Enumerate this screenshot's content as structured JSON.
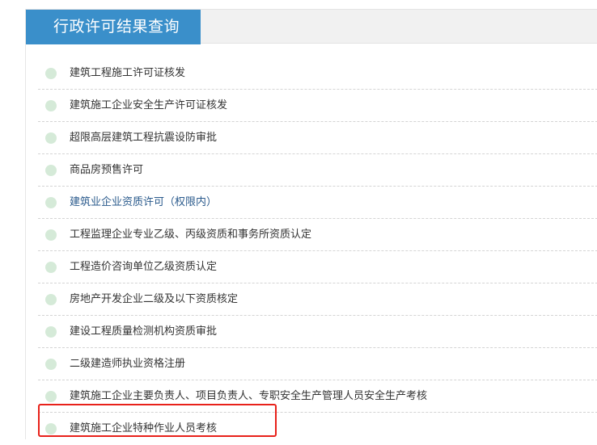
{
  "header": {
    "title": "行政许可结果查询"
  },
  "items": [
    {
      "label": "建筑工程施工许可证核发",
      "link_style": false
    },
    {
      "label": "建筑施工企业安全生产许可证核发",
      "link_style": false
    },
    {
      "label": "超限高层建筑工程抗震设防审批",
      "link_style": false
    },
    {
      "label": "商品房预售许可",
      "link_style": false
    },
    {
      "label": "建筑业企业资质许可（权限内）",
      "link_style": true
    },
    {
      "label": "工程监理企业专业乙级、丙级资质和事务所资质认定",
      "link_style": false
    },
    {
      "label": "工程造价咨询单位乙级资质认定",
      "link_style": false
    },
    {
      "label": "房地产开发企业二级及以下资质核定",
      "link_style": false
    },
    {
      "label": "建设工程质量检测机构资质审批",
      "link_style": false
    },
    {
      "label": "二级建造师执业资格注册",
      "link_style": false
    },
    {
      "label": "建筑施工企业主要负责人、项目负责人、专职安全生产管理人员安全生产考核",
      "link_style": false
    },
    {
      "label": "建筑施工企业特种作业人员考核",
      "link_style": false,
      "highlighted": true
    }
  ],
  "colors": {
    "header_tab": "#3a8fca",
    "header_bar": "#f1f1f1",
    "bullet": "#d5ead8",
    "link_text": "#2a5a8c",
    "text": "#333333",
    "highlight_border": "#e8211a"
  }
}
